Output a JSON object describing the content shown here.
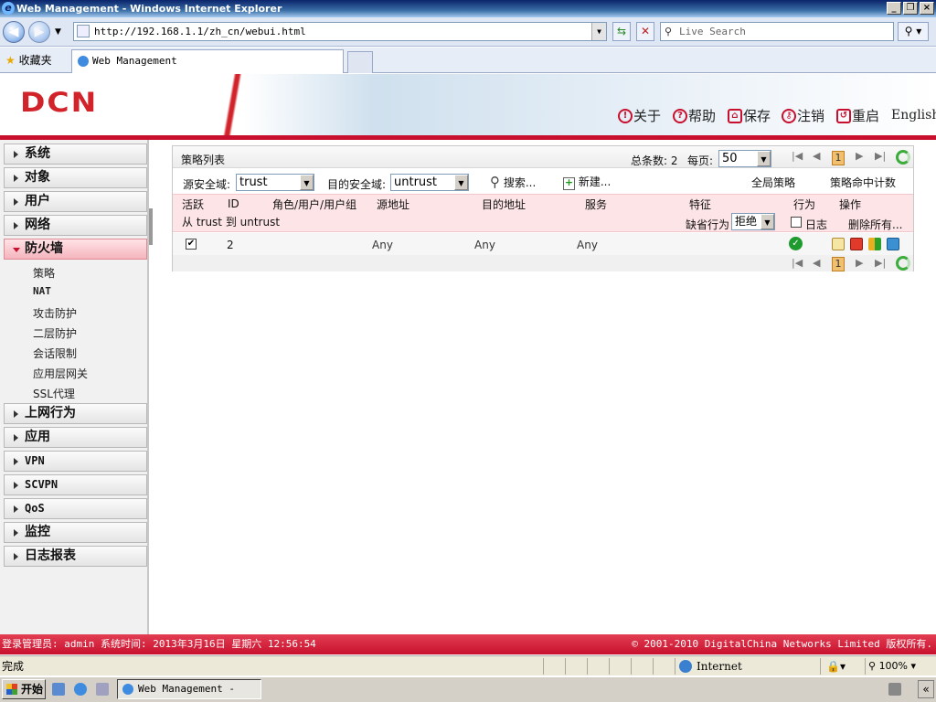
{
  "window": {
    "title": "Web Management - Windows Internet Explorer"
  },
  "browser": {
    "address": "http://192.168.1.1/zh_cn/webui.html",
    "search_placeholder": "Live Search",
    "favorites_label": "收藏夹",
    "tab_title": "Web Management",
    "status_text": "完成",
    "zone": "Internet",
    "zoom": "100%"
  },
  "header": {
    "logo": "DCN",
    "links": [
      {
        "icon": "info-icon",
        "label": "关于"
      },
      {
        "icon": "help-icon",
        "label": "帮助"
      },
      {
        "icon": "save-icon",
        "label": "保存"
      },
      {
        "icon": "logout-icon",
        "label": "注销"
      },
      {
        "icon": "restart-icon",
        "label": "重启"
      },
      {
        "label": "English"
      }
    ]
  },
  "sidebar": {
    "items": [
      {
        "label": "系统"
      },
      {
        "label": "对象"
      },
      {
        "label": "用户"
      },
      {
        "label": "网络"
      },
      {
        "label": "防火墙",
        "active": true
      },
      {
        "label": "上网行为"
      },
      {
        "label": "应用"
      },
      {
        "label": "VPN"
      },
      {
        "label": "SCVPN"
      },
      {
        "label": "QoS"
      },
      {
        "label": "监控"
      },
      {
        "label": "日志报表"
      }
    ],
    "firewall_sub": [
      "策略",
      "NAT",
      "攻击防护",
      "二层防护",
      "会话限制",
      "应用层网关",
      "SSL代理"
    ]
  },
  "policy": {
    "title": "策略列表",
    "total_label": "总条数: 2",
    "per_page_label": "每页:",
    "per_page_value": "50",
    "current_page": "1",
    "src_zone_label": "源安全域:",
    "src_zone_value": "trust",
    "dst_zone_label": "目的安全域:",
    "dst_zone_value": "untrust",
    "search_label": "搜索...",
    "new_label": "新建...",
    "global_policy": "全局策略",
    "hit_count": "策略命中计数",
    "columns": [
      "活跃",
      "ID",
      "角色/用户/用户组",
      "源地址",
      "目的地址",
      "服务",
      "特征",
      "行为",
      "操作"
    ],
    "group_label": "从 trust 到 untrust",
    "default_action_label": "缺省行为",
    "default_action_value": "拒绝",
    "log_label": "日志",
    "delete_all": "删除所有...",
    "rows": [
      {
        "active": true,
        "id": "2",
        "src": "Any",
        "dst": "Any",
        "service": "Any",
        "action": "permit"
      }
    ]
  },
  "footer": {
    "login_info": "登录管理员: admin 系统时间: 2013年3月16日 星期六 12:56:54",
    "copyright": "© 2001-2010 DigitalChina Networks Limited 版权所有."
  },
  "taskbar": {
    "start_label": "开始",
    "task_title": "Web Management - Wi..."
  }
}
